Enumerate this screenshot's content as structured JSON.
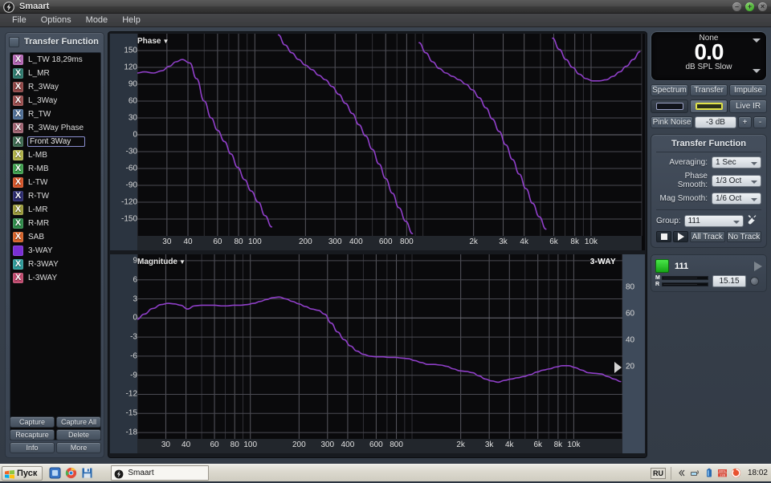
{
  "window": {
    "title": "Smaart",
    "app_icon": "smaart-logo-icon",
    "minimize_label": "–",
    "maximize_label": "+",
    "close_label": "×"
  },
  "menubar": {
    "items": [
      {
        "label": "File"
      },
      {
        "label": "Options"
      },
      {
        "label": "Mode"
      },
      {
        "label": "Help"
      }
    ]
  },
  "sidebar": {
    "title": "Transfer Function",
    "traces": [
      {
        "label": "L_TW 18,29ms",
        "color": "#b468b4",
        "marker": "X",
        "selected": false
      },
      {
        "label": "L_MR",
        "color": "#2f7a6e",
        "marker": "X",
        "selected": false
      },
      {
        "label": "R_3Way",
        "color": "#8f4646",
        "marker": "X",
        "selected": false
      },
      {
        "label": "L_3Way",
        "color": "#9a4f4f",
        "marker": "X",
        "selected": false
      },
      {
        "label": "R_TW",
        "color": "#4f6f96",
        "marker": "X",
        "selected": false
      },
      {
        "label": "R_3Way Phase",
        "color": "#a06472",
        "marker": "X",
        "selected": false
      },
      {
        "label": "Front 3Way",
        "color": "#3f6b52",
        "marker": "X",
        "selected": true
      },
      {
        "label": "L-MB",
        "color": "#b0b24a",
        "marker": "X",
        "selected": false
      },
      {
        "label": "R-MB",
        "color": "#3f9f4f",
        "marker": "X",
        "selected": false
      },
      {
        "label": "L-TW",
        "color": "#d4552a",
        "marker": "X",
        "selected": false
      },
      {
        "label": "R-TW",
        "color": "#2b2b6e",
        "marker": "X",
        "selected": false
      },
      {
        "label": "L-MR",
        "color": "#9a9a3c",
        "marker": "X",
        "selected": false
      },
      {
        "label": "R-MR",
        "color": "#2f8a4a",
        "marker": "X",
        "selected": false
      },
      {
        "label": "SAB",
        "color": "#d4622a",
        "marker": "X",
        "selected": false
      },
      {
        "label": "3-WAY",
        "color": "#7a2fd4",
        "marker": "",
        "selected": false
      },
      {
        "label": "R-3WAY",
        "color": "#2f9a9a",
        "marker": "X",
        "selected": false
      },
      {
        "label": "L-3WAY",
        "color": "#c04a6e",
        "marker": "X",
        "selected": false
      }
    ],
    "buttons": [
      {
        "label": "Capture"
      },
      {
        "label": "Capture All"
      },
      {
        "label": "Recapture"
      },
      {
        "label": "Delete"
      },
      {
        "label": "Info"
      },
      {
        "label": "More"
      }
    ]
  },
  "meter": {
    "source": "None",
    "value": "0.0",
    "unit": "dB SPL Slow"
  },
  "mode_tabs": [
    {
      "label": "Spectrum",
      "active": false
    },
    {
      "label": "Transfer",
      "active": true
    },
    {
      "label": "Impulse",
      "active": false
    }
  ],
  "generator_row": {
    "slot1_active": false,
    "slot2_active": true,
    "live_ir_label": "Live IR"
  },
  "signal_row": {
    "pink_noise_label": "Pink Noise",
    "level": "-3 dB",
    "plus_label": "+",
    "minus_label": "-"
  },
  "transfer_function": {
    "title": "Transfer Function",
    "fields": [
      {
        "label": "Averaging:",
        "value": "1 Sec"
      },
      {
        "label": "Phase Smooth:",
        "value": "1/3 Oct"
      },
      {
        "label": "Mag Smooth:",
        "value": "1/6 Oct"
      }
    ],
    "group_label": "Group:",
    "group_value": "111",
    "tools_icon": "wrench-icon",
    "stop_icon": "stop-icon",
    "play_icon": "play-icon",
    "all_track_label": "All Track",
    "no_track_label": "No Track"
  },
  "group_panel": {
    "name": "111",
    "meter_m_label": "M",
    "meter_r_label": "R",
    "delay_value": "15.15",
    "play_icon": "play-icon",
    "knob": "rotary-knob-icon"
  },
  "taskbar": {
    "start_label": "Пуск",
    "quick_launch": [
      "show-desktop-icon",
      "chrome-icon",
      "save-icon"
    ],
    "tasks": [
      {
        "label": "Smaart",
        "icon": "smaart-logo-icon"
      }
    ],
    "tray": {
      "language": "RU",
      "icons": [
        "chevron-left-icon",
        "network-icon",
        "battery-icon",
        "update-icon",
        "antivirus-icon"
      ],
      "clock": "18:02"
    }
  },
  "chart_data": [
    {
      "type": "line",
      "title": "Phase",
      "id": "phase",
      "xlabel": "",
      "ylabel": "Phase (degrees)",
      "xscale": "log",
      "xlim": [
        20,
        20000
      ],
      "ylim": [
        -180,
        180
      ],
      "yticks": [
        150,
        120,
        90,
        60,
        30,
        0,
        -30,
        -60,
        -90,
        -120,
        -150
      ],
      "xticks": [
        30,
        40,
        60,
        80,
        100,
        200,
        300,
        400,
        600,
        800,
        2000,
        3000,
        4000,
        6000,
        8000,
        10000
      ],
      "xticklabels": [
        "30",
        "40",
        "60",
        "80",
        "100",
        "200",
        "300",
        "400",
        "600",
        "800",
        "2k",
        "3k",
        "4k",
        "6k",
        "8k",
        "10k"
      ],
      "grid": true,
      "series": [
        {
          "name": "Front 3Way",
          "color": "#8f3fc8",
          "x": [
            20,
            22,
            25,
            28,
            31,
            34,
            37,
            41,
            45,
            50,
            55,
            60,
            66,
            72,
            79,
            87,
            95,
            105,
            115,
            126,
            138,
            151,
            166,
            182,
            200,
            219,
            240,
            263,
            288,
            316,
            346,
            380,
            416,
            456,
            500,
            548,
            600,
            658,
            720,
            790,
            866,
            949,
            1040,
            1140,
            1250,
            1370,
            1500,
            1640,
            1800,
            1970,
            2160,
            2370,
            2590,
            2840,
            3110,
            3410,
            3740,
            4100,
            4490,
            4920,
            5390,
            5900,
            6470,
            7090,
            7760,
            8510,
            9320,
            10200,
            11200,
            12300,
            13500,
            14800,
            16200,
            17800,
            19500
          ],
          "y": [
            110,
            112,
            110,
            114,
            122,
            130,
            134,
            128,
            100,
            60,
            30,
            8,
            -12,
            -34,
            -58,
            -80,
            -100,
            -120,
            -144,
            -164,
            178,
            160,
            146,
            134,
            124,
            116,
            106,
            98,
            86,
            72,
            56,
            38,
            18,
            -2,
            -26,
            -52,
            -78,
            -104,
            -130,
            -154,
            -176,
            164,
            146,
            130,
            118,
            110,
            104,
            98,
            90,
            80,
            66,
            48,
            28,
            6,
            -18,
            -44,
            -70,
            -96,
            -122,
            -146,
            -168,
            172,
            152,
            134,
            120,
            108,
            100,
            96,
            96,
            98,
            104,
            112,
            122,
            134,
            148
          ]
        }
      ]
    },
    {
      "type": "line",
      "title": "Magnitude",
      "id": "magnitude",
      "corner_label": "3-WAY",
      "xlabel": "",
      "ylabel": "Magnitude (dB)",
      "xscale": "log",
      "xlim": [
        20,
        20000
      ],
      "ylim": [
        -19,
        10
      ],
      "yticks": [
        9,
        6,
        3,
        0,
        -3,
        -6,
        -9,
        -12,
        -15,
        -18
      ],
      "yticks_right": [
        80,
        60,
        40,
        20
      ],
      "xticks": [
        30,
        40,
        60,
        80,
        100,
        200,
        300,
        400,
        600,
        800,
        2000,
        3000,
        4000,
        6000,
        8000,
        10000
      ],
      "xticklabels": [
        "30",
        "40",
        "60",
        "80",
        "100",
        "200",
        "300",
        "400",
        "600",
        "800",
        "2k",
        "3k",
        "4k",
        "6k",
        "8k",
        "10k"
      ],
      "grid": true,
      "cursor_marker_value": 20,
      "series": [
        {
          "name": "Front 3Way",
          "color": "#8f3fc8",
          "x": [
            20,
            22,
            25,
            28,
            31,
            34,
            37,
            41,
            45,
            50,
            55,
            60,
            66,
            72,
            79,
            87,
            95,
            105,
            115,
            126,
            138,
            151,
            166,
            182,
            200,
            219,
            240,
            263,
            288,
            316,
            346,
            380,
            416,
            456,
            500,
            548,
            600,
            658,
            720,
            790,
            866,
            949,
            1040,
            1140,
            1250,
            1370,
            1500,
            1640,
            1800,
            1970,
            2160,
            2370,
            2590,
            2840,
            3110,
            3410,
            3740,
            4100,
            4490,
            4920,
            5390,
            5900,
            6470,
            7090,
            7760,
            8510,
            9320,
            10200,
            11200,
            12300,
            13500,
            14800,
            16200,
            17800,
            19500
          ],
          "y": [
            -0.2,
            0.6,
            1.5,
            2.1,
            2.3,
            2.2,
            2.0,
            1.4,
            1.9,
            2.0,
            2.0,
            2.0,
            1.9,
            1.9,
            2.0,
            2.0,
            2.1,
            2.3,
            2.6,
            2.9,
            3.2,
            3.3,
            3.0,
            2.6,
            2.2,
            1.8,
            1.4,
            1.2,
            0.6,
            -0.8,
            -2.2,
            -3.4,
            -4.4,
            -5.2,
            -5.7,
            -6.0,
            -6.1,
            -6.1,
            -6.2,
            -6.2,
            -6.3,
            -6.4,
            -6.7,
            -7.0,
            -7.3,
            -7.3,
            -7.4,
            -7.6,
            -8.0,
            -8.3,
            -8.4,
            -8.6,
            -9.1,
            -9.6,
            -9.9,
            -10.1,
            -9.8,
            -9.6,
            -9.4,
            -9.2,
            -8.9,
            -8.5,
            -8.2,
            -8.0,
            -7.7,
            -7.5,
            -7.5,
            -7.8,
            -8.2,
            -8.6,
            -8.7,
            -8.8,
            -9.2,
            -9.6,
            -10.0
          ]
        }
      ]
    }
  ]
}
